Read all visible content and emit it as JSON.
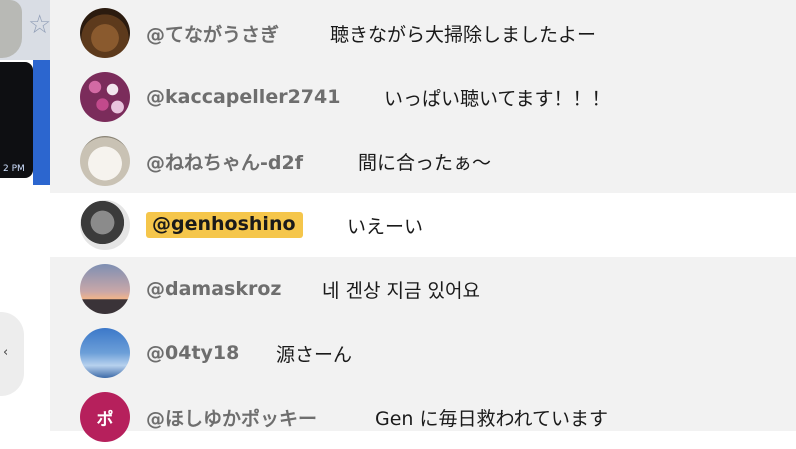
{
  "left_panel": {
    "timestamp_fragment": "2 PM",
    "side_button_glyph": "‹"
  },
  "chat": {
    "messages": [
      {
        "author": "@てながうさぎ",
        "text": "聴きながら大掃除しましたよー",
        "avatar": "teddy-bear-avatar"
      },
      {
        "author": "@kaccapeller2741",
        "text": "いっぱい聴いてます！！！",
        "avatar": "flowers-avatar"
      },
      {
        "author": "@ねねちゃん-d2f",
        "text": "間に合ったぁ〜",
        "avatar": "cat-avatar"
      },
      {
        "author": "@genhoshino",
        "text": "いえーい",
        "avatar": "profile-photo-avatar",
        "highlighted": true
      },
      {
        "author": "@damaskroz",
        "text": "네 겐상 지금 있어요",
        "avatar": "sunset-avatar"
      },
      {
        "author": "@04ty18",
        "text": "源さーん",
        "avatar": "sky-avatar"
      },
      {
        "author": "@ほしゆかポッキー",
        "text": "Gen に毎日救われています",
        "avatar": "initial-avatar",
        "avatar_letter": "ポ"
      }
    ]
  },
  "colors": {
    "owner_badge": "#f5c64b",
    "row_background": "#f2f2f2",
    "highlight_row": "#ffffff",
    "author_text": "#6e6e6e"
  }
}
